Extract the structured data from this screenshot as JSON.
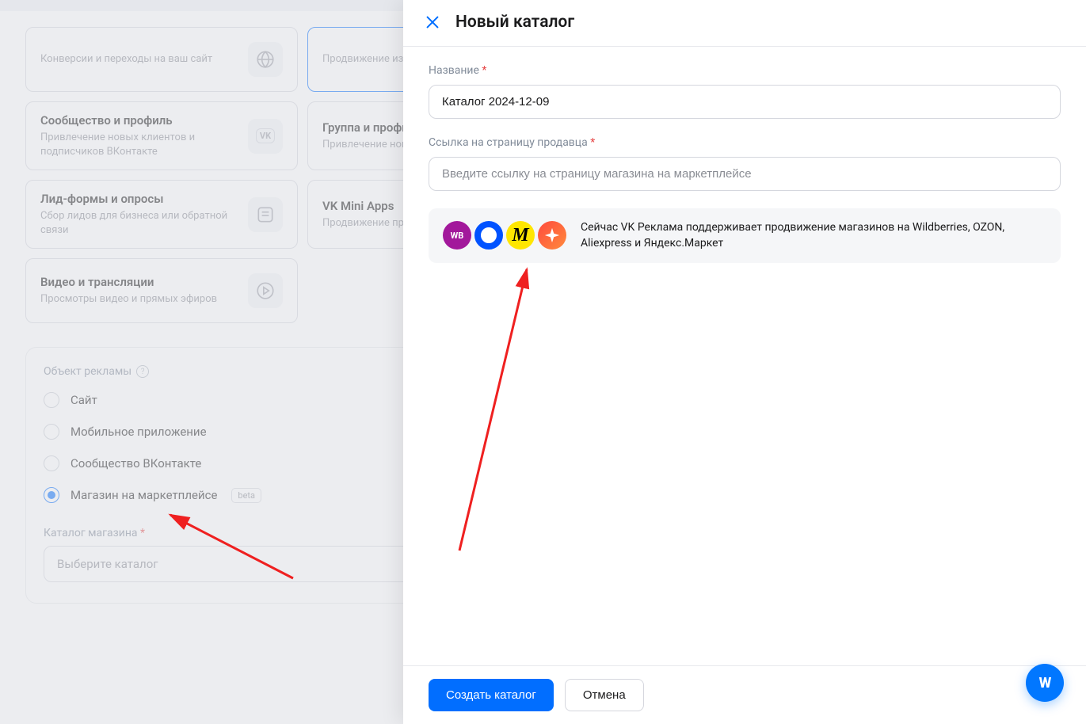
{
  "cards": {
    "conversions_title": "Конверсии и переходы на ваш сайт",
    "conversions_sub": "",
    "catalog_title": "Продвижение из каталога",
    "catalog_sub": "",
    "community_title": "Сообщество и профиль",
    "community_sub": "Привлечение новых клиентов и подписчиков ВКонтакте",
    "group_title": "Группа и профиль",
    "group_sub": "Привлечение новых клиентов и подписчиков",
    "leads_title": "Лид-формы и опросы",
    "leads_sub": "Сбор лидов для бизнеса или обратной связи",
    "miniapps_title": "VK Mini Apps",
    "miniapps_sub": "Продвижение приложений и",
    "video_title": "Видео и трансляции",
    "video_sub": "Просмотры видео и прямых эфиров"
  },
  "ad_object": {
    "label": "Объект рекламы",
    "options": {
      "site": "Сайт",
      "mobile": "Мобильное приложение",
      "community": "Сообщество ВКонтакте",
      "marketplace": "Магазин на маркетплейсе",
      "beta": "beta"
    },
    "catalog_label": "Каталог магазина",
    "catalog_placeholder": "Выберите каталог"
  },
  "panel": {
    "title": "Новый каталог",
    "name_label": "Название",
    "name_value": "Каталог 2024-12-09",
    "link_label": "Ссылка на страницу продавца",
    "link_placeholder": "Введите ссылку на страницу магазина на маркетплейсе",
    "wb_label": "WB",
    "al_label": "M",
    "info_text": "Сейчас VK Реклама поддерживает продвижение магазинов на Wildberries, OZON, Aliexpress и Яндекс.Маркет",
    "create": "Создать каталог",
    "cancel": "Отмена"
  },
  "fab": "W"
}
